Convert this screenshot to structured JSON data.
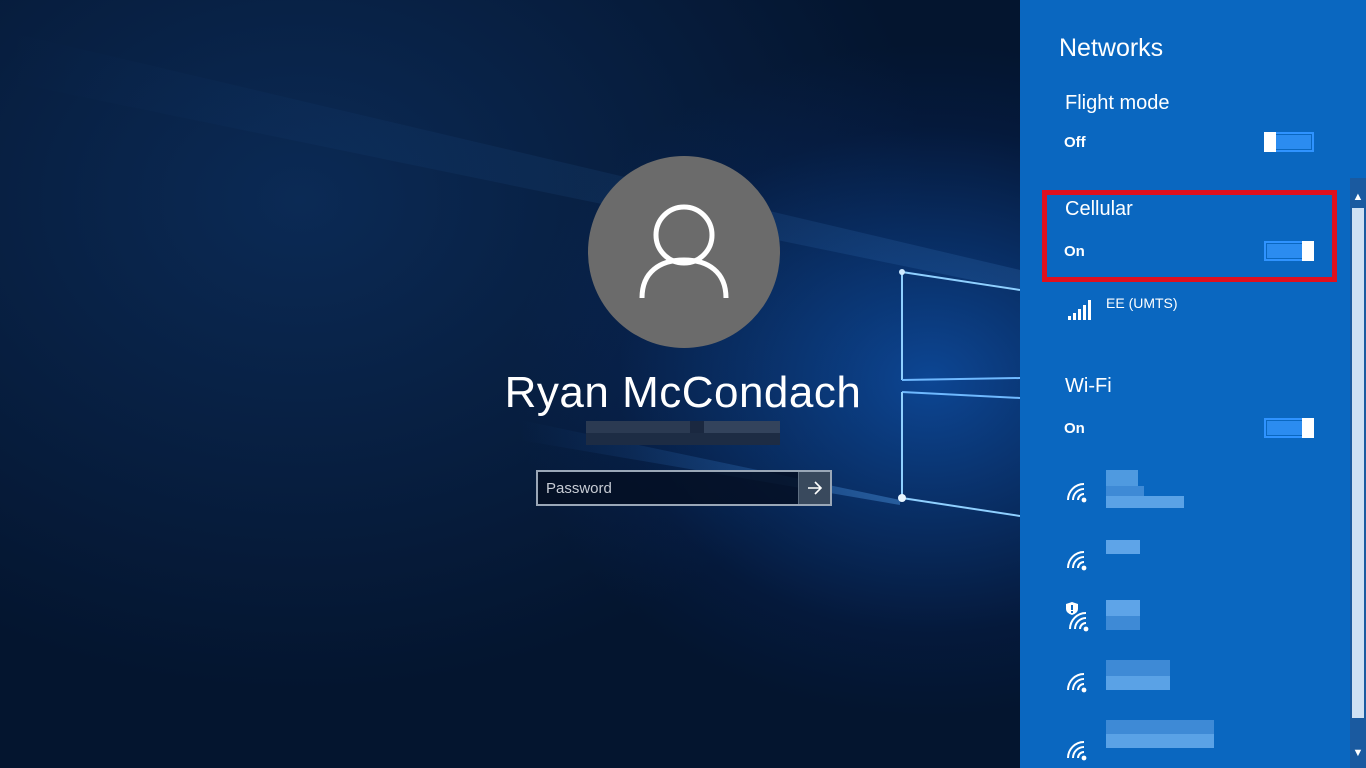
{
  "lock_screen": {
    "user_name": "Ryan McCondach",
    "password": {
      "placeholder": "Password",
      "value": ""
    },
    "submit_icon": "arrow-right-icon",
    "avatar_icon": "user-icon"
  },
  "networks": {
    "title": "Networks",
    "flight_mode": {
      "title": "Flight mode",
      "state": "Off",
      "enabled": false
    },
    "cellular": {
      "title": "Cellular",
      "state": "On",
      "enabled": true,
      "network": {
        "name": "EE (UMTS)",
        "icon": "cellular-signal-icon"
      }
    },
    "wifi": {
      "title": "Wi-Fi",
      "state": "On",
      "enabled": true,
      "networks": [
        {
          "icon": "wifi-signal-icon",
          "secured": true
        },
        {
          "icon": "wifi-signal-icon",
          "secured": true
        },
        {
          "icon": "wifi-warning-icon",
          "secured": false
        },
        {
          "icon": "wifi-signal-icon",
          "secured": true
        },
        {
          "icon": "wifi-signal-icon",
          "secured": true
        }
      ]
    }
  },
  "colors": {
    "flyout_bg": "#0a67c0",
    "toggle_accent": "#2b8cf0",
    "highlight": "#e0101e",
    "avatar_bg": "#6b6b6b"
  }
}
